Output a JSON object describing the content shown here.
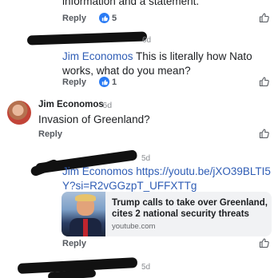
{
  "comments": [
    {
      "id": "c0",
      "text_tail": "information and a statement.",
      "reply_label": "Reply",
      "reaction_count": "5"
    },
    {
      "id": "c1",
      "time": "6d",
      "mention": "Jim Economos",
      "text": " This is literally how Nato works, what do you mean?",
      "reply_label": "Reply",
      "reaction_count": "1"
    },
    {
      "id": "c2",
      "author": "Jim Economos",
      "time_label": "· 6d",
      "text": "Invasion of Greenland?",
      "reply_label": "Reply"
    },
    {
      "id": "c3",
      "time": "5d",
      "mention": "Jim Economos",
      "link_text": "https://youtu.be/jXO39BLTI5Y?si=R2vGGzpT_UFFXTTg",
      "link_preview": {
        "title": "Trump calls to take over Greenland, cites 2 national security threats",
        "domain": "youtube.com"
      },
      "reply_label": "Reply"
    },
    {
      "id": "c4",
      "time": "5d"
    }
  ],
  "colors": {
    "mention": "#2f5db5",
    "like_blue": "#2a7bf4",
    "redaction": "#111111"
  },
  "icons": {
    "reaction": "thumbs-up-icon",
    "like": "thumbs-up-outline-icon"
  }
}
